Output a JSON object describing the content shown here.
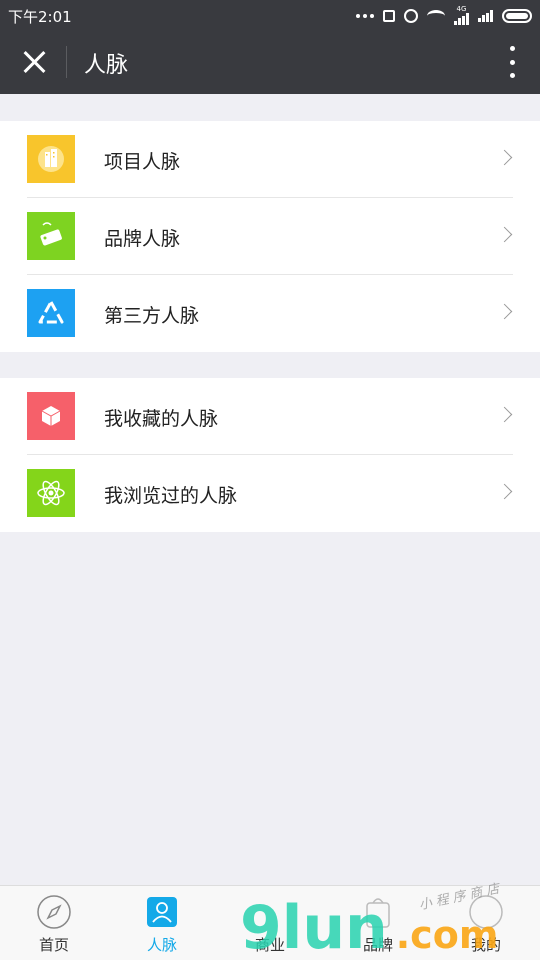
{
  "status_bar": {
    "time": "下午2:01",
    "network": "4G"
  },
  "nav": {
    "title": "人脉"
  },
  "groups": [
    {
      "items": [
        {
          "label": "项目人脉",
          "icon": "building-icon",
          "color": "#f8c52c"
        },
        {
          "label": "品牌人脉",
          "icon": "sale-tag-icon",
          "color": "#7ed321"
        },
        {
          "label": "第三方人脉",
          "icon": "recycle-triangle-icon",
          "color": "#1da1f2"
        }
      ]
    },
    {
      "items": [
        {
          "label": "我收藏的人脉",
          "icon": "cube-icon",
          "color": "#f6606a"
        },
        {
          "label": "我浏览过的人脉",
          "icon": "atom-icon",
          "color": "#84d51a"
        }
      ]
    }
  ],
  "tabs": [
    {
      "label": "首页",
      "icon": "compass-icon",
      "active": false
    },
    {
      "label": "人脉",
      "icon": "contacts-icon",
      "active": true
    },
    {
      "label": "商业",
      "icon": "business-icon",
      "active": false
    },
    {
      "label": "品牌",
      "icon": "brand-icon",
      "active": false
    },
    {
      "label": "我的",
      "icon": "profile-icon",
      "active": false
    }
  ],
  "watermark": {
    "text": "9lun",
    "suffix": ".com",
    "handwriting": "小 程 序 商 店"
  },
  "colors": {
    "header": "#393a3f",
    "background": "#efeff4",
    "active_tab": "#14a9e8"
  }
}
